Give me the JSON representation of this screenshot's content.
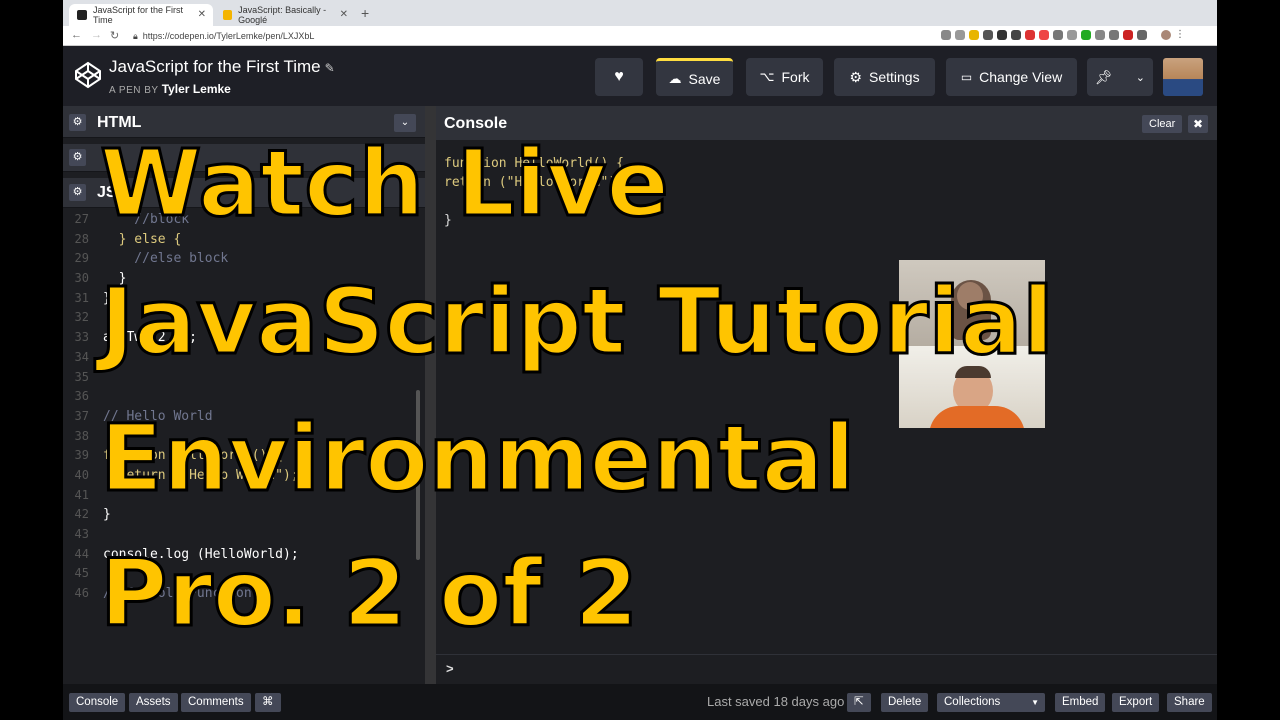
{
  "browser": {
    "tabs": [
      {
        "title": "JavaScript for the First Time",
        "active": true
      },
      {
        "title": "JavaScript: Basically - Googlé",
        "active": false
      }
    ],
    "url": "https://codepen.io/TylerLemke/pen/LXJXbL"
  },
  "pen": {
    "title": "JavaScript for the First Time",
    "by_label": "A PEN BY",
    "author": "Tyler Lemke"
  },
  "header_buttons": {
    "save": "Save",
    "fork": "Fork",
    "settings": "Settings",
    "change_view": "Change View"
  },
  "editors": {
    "html_label": "HTML",
    "js_label": "JS"
  },
  "code_lines": [
    {
      "n": "27",
      "t": "    //block"
    },
    {
      "n": "28",
      "t": "  } else {"
    },
    {
      "n": "29",
      "t": "    //else block"
    },
    {
      "n": "30",
      "t": "  }"
    },
    {
      "n": "31",
      "t": "}"
    },
    {
      "n": "32",
      "t": ""
    },
    {
      "n": "33",
      "t": "addTwo(2,4);"
    },
    {
      "n": "34",
      "t": ""
    },
    {
      "n": "35",
      "t": ""
    },
    {
      "n": "36",
      "t": ""
    },
    {
      "n": "37",
      "t": "// Hello World"
    },
    {
      "n": "38",
      "t": ""
    },
    {
      "n": "39",
      "t": "function HelloWorld() {"
    },
    {
      "n": "40",
      "t": "  return (\"Hello World\");"
    },
    {
      "n": "41",
      "t": ""
    },
    {
      "n": "42",
      "t": "}"
    },
    {
      "n": "43",
      "t": ""
    },
    {
      "n": "44",
      "t": "console.log (HelloWorld);"
    },
    {
      "n": "45",
      "t": ""
    },
    {
      "n": "46",
      "t": "// Console Function"
    }
  ],
  "console": {
    "title": "Console",
    "clear": "Clear",
    "close": "✖",
    "output": [
      "function HelloWorld() {",
      "return (\"Hello World\");",
      "",
      "}"
    ],
    "prompt": ">"
  },
  "footer": {
    "console": "Console",
    "assets": "Assets",
    "comments": "Comments",
    "shortcut": "⌘",
    "last_saved": "Last saved 18 days ago",
    "delete": "Delete",
    "collections": "Collections",
    "embed": "Embed",
    "export": "Export",
    "share": "Share"
  },
  "overlay": {
    "line1": "Watch Live",
    "line2": "JavaScript Tutorial",
    "line3": "Environmental",
    "line4": "Pro. 2 of 2"
  },
  "colors": {
    "overlay_text": "#ffc400",
    "save_accent": "#ffdd40",
    "editor_bg": "#1d1e22"
  }
}
